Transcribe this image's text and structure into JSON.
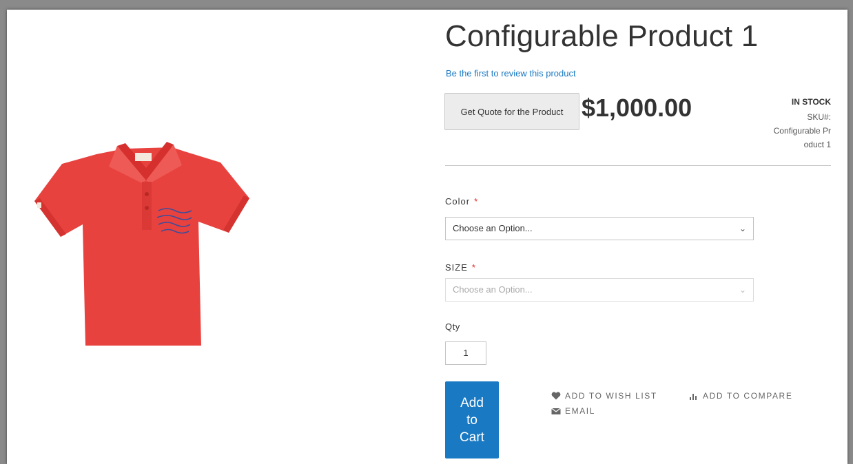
{
  "product": {
    "title": "Configurable Product 1",
    "review_link": "Be the first to review this product",
    "quote_button": "Get Quote for the Product",
    "price": "$1,000.00",
    "stock": "IN STOCK",
    "sku_label": "SKU#:",
    "sku_value": "Configurable Product 1",
    "image_icon": "red-polo-shirt-image"
  },
  "options": {
    "color_label": "Color",
    "color_value": "Choose an Option...",
    "size_label": "SIZE",
    "size_value": "Choose an Option...",
    "required_mark": "*"
  },
  "qty": {
    "label": "Qty",
    "value": "1"
  },
  "actions": {
    "add_to_cart": "Add to Cart",
    "wish_list": "ADD TO WISH LIST",
    "compare": "ADD TO COMPARE",
    "email": "EMAIL"
  },
  "colors": {
    "accent": "#1979c3",
    "shirt": "#e8423f",
    "required": "#e02b27"
  }
}
